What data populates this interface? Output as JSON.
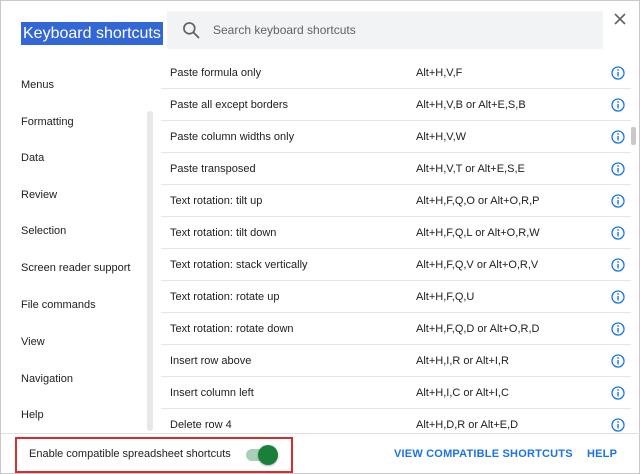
{
  "header": {
    "title": "Keyboard shortcuts",
    "search_placeholder": "Search keyboard shortcuts",
    "search_icon": "search-icon",
    "close_icon": "close-icon"
  },
  "sidebar": {
    "items": [
      {
        "label": "Menus"
      },
      {
        "label": "Formatting"
      },
      {
        "label": "Data"
      },
      {
        "label": "Review"
      },
      {
        "label": "Selection"
      },
      {
        "label": "Screen reader support"
      },
      {
        "label": "File commands"
      },
      {
        "label": "View"
      },
      {
        "label": "Navigation"
      },
      {
        "label": "Help"
      }
    ]
  },
  "shortcuts": [
    {
      "name": "Paste formula only",
      "keys": "Alt+H,V,F"
    },
    {
      "name": "Paste all except borders",
      "keys": "Alt+H,V,B or Alt+E,S,B"
    },
    {
      "name": "Paste column widths only",
      "keys": "Alt+H,V,W"
    },
    {
      "name": "Paste transposed",
      "keys": "Alt+H,V,T or Alt+E,S,E"
    },
    {
      "name": "Text rotation: tilt up",
      "keys": "Alt+H,F,Q,O or Alt+O,R,P"
    },
    {
      "name": "Text rotation: tilt down",
      "keys": "Alt+H,F,Q,L or Alt+O,R,W"
    },
    {
      "name": "Text rotation: stack vertically",
      "keys": "Alt+H,F,Q,V or Alt+O,R,V"
    },
    {
      "name": "Text rotation: rotate up",
      "keys": "Alt+H,F,Q,U"
    },
    {
      "name": "Text rotation: rotate down",
      "keys": "Alt+H,F,Q,D or Alt+O,R,D"
    },
    {
      "name": "Insert row above",
      "keys": "Alt+H,I,R or Alt+I,R"
    },
    {
      "name": "Insert column left",
      "keys": "Alt+H,I,C or Alt+I,C"
    },
    {
      "name": "Delete row 4",
      "keys": "Alt+H,D,R or Alt+E,D"
    }
  ],
  "footer": {
    "toggle_label": "Enable compatible spreadsheet shortcuts",
    "toggle_on": true,
    "view_compatible_label": "VIEW COMPATIBLE SHORTCUTS",
    "help_label": "HELP"
  },
  "colors": {
    "accent": "#1a73e8",
    "toggle_on": "#188038",
    "title_highlight": "#3367d6",
    "annotation_border": "#d32f2f"
  }
}
